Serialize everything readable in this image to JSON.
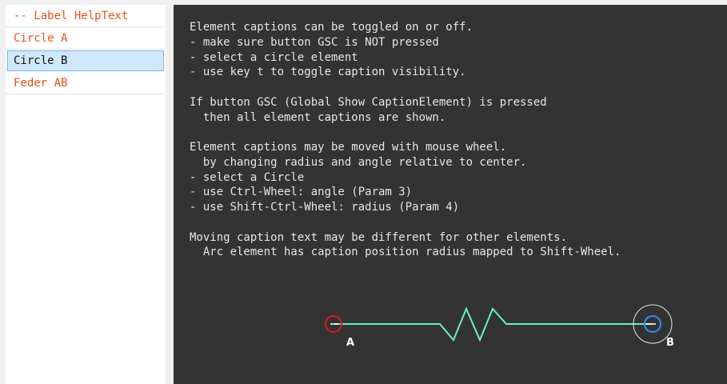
{
  "sidebar": {
    "items": [
      {
        "label": "-- Label HelpText",
        "selected": false
      },
      {
        "label": "Circle A",
        "selected": false
      },
      {
        "label": "Circle B",
        "selected": true
      },
      {
        "label": "Feder AB",
        "selected": false
      }
    ]
  },
  "canvas": {
    "background": "#333333",
    "help_lines": [
      "Element captions can be toggled on or off.",
      "- make sure button GSC is NOT pressed",
      "- select a circle element",
      "- use key t to toggle caption visibility.",
      "",
      "If button GSC (Global Show CaptionElement) is pressed",
      "  then all element captions are shown.",
      "",
      "Element captions may be moved with mouse wheel.",
      "  by changing radius and angle relative to center.",
      "- select a Circle",
      "- use Ctrl-Wheel: angle (Param 3)",
      "- use Shift-Ctrl-Wheel: radius (Param 4)",
      "",
      "Moving caption text may be different for other elements.",
      "  Arc element has caption position radius mapped to Shift-Wheel."
    ],
    "circle_a": {
      "caption": "A",
      "color": "#e0141e"
    },
    "circle_b": {
      "caption": "B",
      "color": "#2f8fff",
      "selected": true
    },
    "spring": {
      "name": "Feder AB",
      "color": "#66f0c8"
    }
  },
  "colors": {
    "item_text": "#e8501a",
    "selected_bg": "#cfe8fc",
    "selected_border": "#7eb4ea"
  }
}
